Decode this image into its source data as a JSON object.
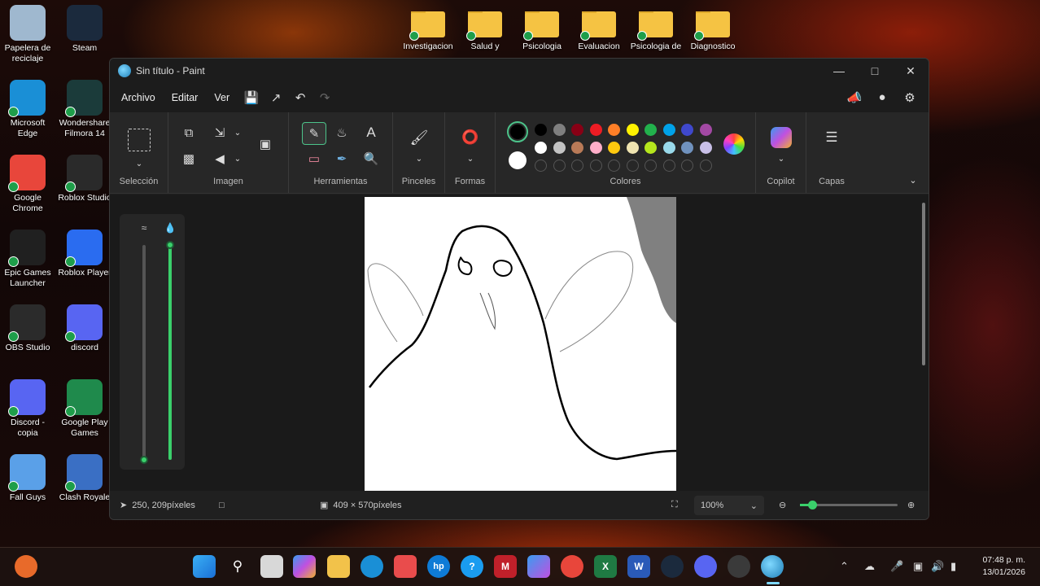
{
  "desktop": {
    "left_icons": [
      {
        "label": "Papelera de reciclaje",
        "icon": "recycle-bin-icon",
        "color": "#9fb8cf"
      },
      {
        "label": "Steam",
        "icon": "steam-icon",
        "color": "#1b2a3d"
      },
      {
        "label": "Microsoft Edge",
        "icon": "edge-icon",
        "color": "#1a8fd6"
      },
      {
        "label": "Wondershare Filmora 14",
        "icon": "filmora-icon",
        "color": "#1b3b3a"
      },
      {
        "label": "Google Chrome",
        "icon": "chrome-icon",
        "color": "#e8463b"
      },
      {
        "label": "Roblox Studio",
        "icon": "roblox-studio-icon",
        "color": "#2a2a2a"
      },
      {
        "label": "Epic Games Launcher",
        "icon": "epic-games-icon",
        "color": "#202020"
      },
      {
        "label": "Roblox Player",
        "icon": "roblox-player-icon",
        "color": "#2a6cf0"
      },
      {
        "label": "OBS Studio",
        "icon": "obs-icon",
        "color": "#2b2b2b"
      },
      {
        "label": "discord",
        "icon": "discord-icon",
        "color": "#5865f2"
      },
      {
        "label": "Discord - copia",
        "icon": "discord-icon",
        "color": "#5865f2"
      },
      {
        "label": "Google Play Games",
        "icon": "google-play-games-icon",
        "color": "#1f8a4c"
      },
      {
        "label": "Fall Guys",
        "icon": "fall-guys-icon",
        "color": "#5aa0e8"
      },
      {
        "label": "Clash Royale",
        "icon": "clash-royale-icon",
        "color": "#3a6fc4"
      }
    ],
    "folders": [
      "Investigacion",
      "Salud y",
      "Psicologia",
      "Evaluacion",
      "Psicologia de",
      "Diagnostico"
    ]
  },
  "paint": {
    "title": "Sin título - Paint",
    "menu": [
      "Archivo",
      "Editar",
      "Ver"
    ],
    "groups": {
      "seleccion": "Selección",
      "imagen": "Imagen",
      "herramientas": "Herramientas",
      "pinceles": "Pinceles",
      "formas": "Formas",
      "colores": "Colores",
      "copilot": "Copilot",
      "capas": "Capas"
    },
    "palette_row1": [
      "#000000",
      "#7f7f7f",
      "#880015",
      "#ed1c24",
      "#ff7f27",
      "#fff200",
      "#22b14c",
      "#00a2e8",
      "#3f48cc",
      "#a349a4"
    ],
    "palette_row2": [
      "#ffffff",
      "#c3c3c3",
      "#b97a57",
      "#ffaec9",
      "#ffc90e",
      "#efe4b0",
      "#b5e61d",
      "#99d9ea",
      "#7092be",
      "#c8bfe7"
    ],
    "primary_color": "#000000",
    "secondary_color": "#ffffff",
    "status": {
      "cursor_pos": "250, 209píxeles",
      "canvas_size": "409 × 570píxeles",
      "zoom": "100%"
    },
    "sliders": {
      "size_level": 0.0,
      "opacity_level": 1.0
    }
  },
  "taskbar": {
    "time": "07:48 p. m.",
    "date": "13/01/2026"
  }
}
